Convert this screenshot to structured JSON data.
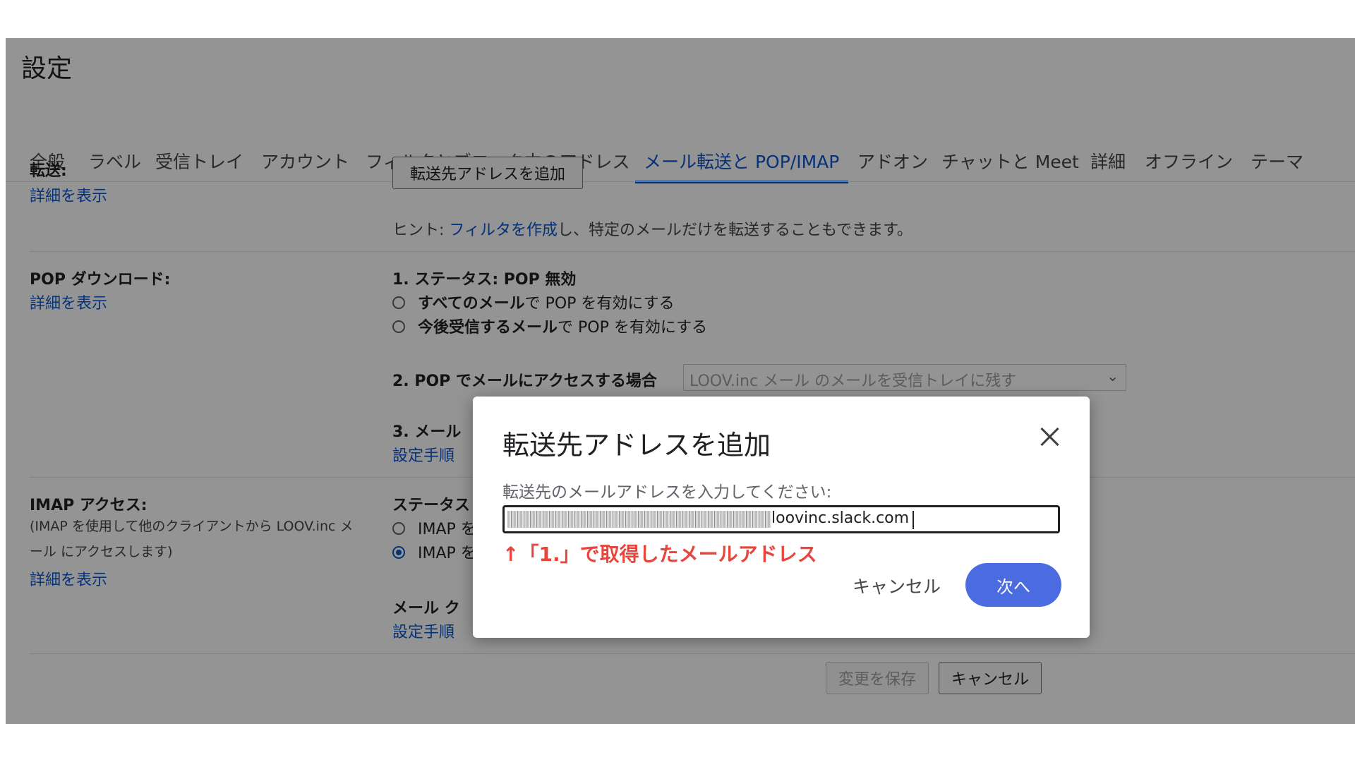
{
  "page": {
    "title": "設定"
  },
  "tabs": [
    {
      "label": "全般",
      "active": false
    },
    {
      "label": "ラベル",
      "active": false
    },
    {
      "label": "受信トレイ",
      "active": false
    },
    {
      "label": "アカウント",
      "active": false
    },
    {
      "label": "フィルタとブロック中のアドレス",
      "active": false
    },
    {
      "label": "メール転送と POP/IMAP",
      "active": true
    },
    {
      "label": "アドオン",
      "active": false
    },
    {
      "label": "チャットと Meet",
      "active": false
    },
    {
      "label": "詳細",
      "active": false
    },
    {
      "label": "オフライン",
      "active": false
    },
    {
      "label": "テーマ",
      "active": false
    }
  ],
  "forwarding": {
    "label": "転送:",
    "details_link": "詳細を表示",
    "add_button": "転送先アドレスを追加",
    "hint_prefix": "ヒント: ",
    "hint_link": "フィルタを作成",
    "hint_suffix": "し、特定のメールだけを転送することもできます。"
  },
  "pop": {
    "label": "POP ダウンロード:",
    "details_link": "詳細を表示",
    "status": "1. ステータス: POP 無効",
    "option1_bold": "すべてのメール",
    "option1_rest": "で POP を有効にする",
    "option2_bold": "今後受信するメール",
    "option2_rest": "で POP を有効にする",
    "access_label": "2. POP でメールにアクセスする場合",
    "access_select_value": "LOOV.inc メール のメールを受信トレイに残す",
    "client_label": "3. メール",
    "setup_link": "設定手順"
  },
  "imap": {
    "label": "IMAP アクセス:",
    "desc_line1": "(IMAP を使用して他のクライアントから LOOV.inc メ",
    "desc_line2": "ール にアクセスします)",
    "details_link": "詳細を表示",
    "status_label": "ステータス",
    "option1": "IMAP を",
    "option2": "IMAP を",
    "client_label": "メール ク",
    "setup_link": "設定手順"
  },
  "footer": {
    "save_button": "変更を保存",
    "cancel_button": "キャンセル"
  },
  "modal": {
    "title": "転送先アドレスを追加",
    "prompt": "転送先のメールアドレスを入力してください:",
    "email_visible_part": "loovinc.slack.com",
    "annotation": "↑「1.」で取得したメールアドレス",
    "cancel_label": "キャンセル",
    "next_label": "次へ"
  },
  "colors": {
    "accent": "#0b57d0",
    "next_button": "#4a6ce0",
    "annotation": "#e8453c"
  }
}
